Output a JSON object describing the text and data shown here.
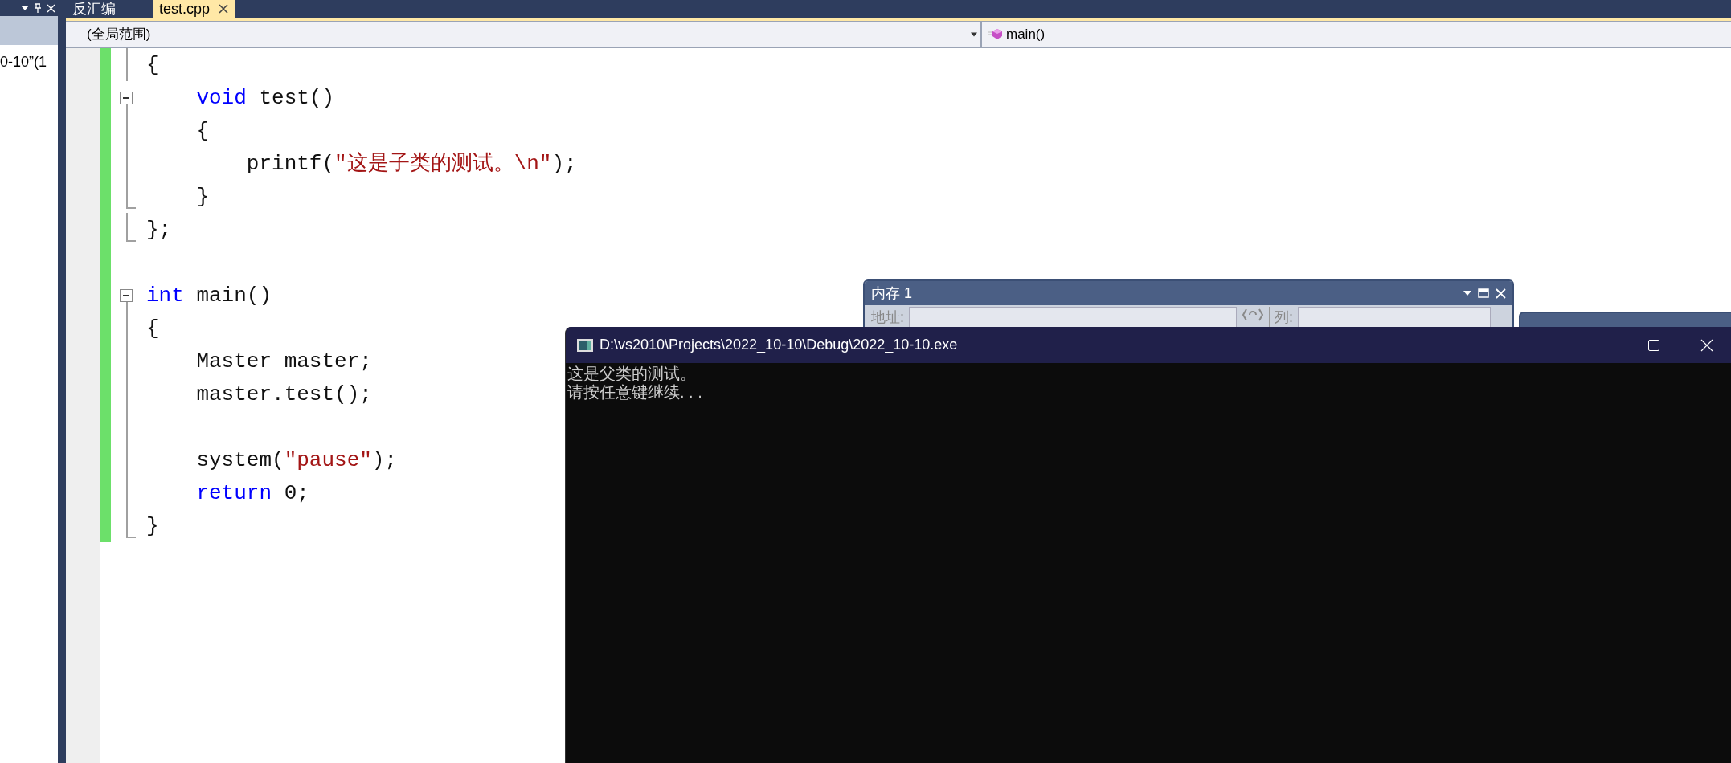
{
  "side_panel": {
    "text": "0-10”(1"
  },
  "tabs": [
    {
      "label": "反汇编",
      "selected": false,
      "closable": false
    },
    {
      "label": "test.cpp",
      "selected": true,
      "closable": true
    }
  ],
  "nav": {
    "scope": "(全局范围)",
    "member": "main()"
  },
  "code": [
    {
      "tokens": [
        {
          "text": "{",
          "kind": "plain"
        }
      ],
      "kind": "body",
      "changed": true
    },
    {
      "tokens": [
        {
          "text": "    void",
          "kind": "keyword"
        },
        {
          "text": " test()",
          "kind": "plain"
        }
      ],
      "kind": "start",
      "changed": true
    },
    {
      "tokens": [
        {
          "text": "    {",
          "kind": "plain"
        }
      ],
      "kind": "body",
      "changed": true
    },
    {
      "tokens": [
        {
          "text": "        printf(",
          "kind": "plain"
        },
        {
          "text": "\"这是子类的测试。\\n\"",
          "kind": "string"
        },
        {
          "text": ");",
          "kind": "plain"
        }
      ],
      "kind": "body",
      "changed": true
    },
    {
      "tokens": [
        {
          "text": "    }",
          "kind": "plain"
        }
      ],
      "kind": "end",
      "changed": true
    },
    {
      "tokens": [
        {
          "text": "};",
          "kind": "plain"
        }
      ],
      "kind": "end",
      "changed": true
    },
    {
      "kind": "blank",
      "changed": true
    },
    {
      "tokens": [
        {
          "text": "int",
          "kind": "keyword"
        },
        {
          "text": " main()",
          "kind": "plain"
        }
      ],
      "kind": "start",
      "changed": true
    },
    {
      "tokens": [
        {
          "text": "{",
          "kind": "plain"
        }
      ],
      "kind": "body",
      "changed": true
    },
    {
      "tokens": [
        {
          "text": "    Master master;",
          "kind": "plain"
        }
      ],
      "kind": "body",
      "changed": true
    },
    {
      "tokens": [
        {
          "text": "    master.test();",
          "kind": "plain"
        }
      ],
      "kind": "body",
      "changed": true
    },
    {
      "kind": "body",
      "changed": true
    },
    {
      "tokens": [
        {
          "text": "    system(",
          "kind": "plain"
        },
        {
          "text": "\"pause\"",
          "kind": "string"
        },
        {
          "text": ");",
          "kind": "plain"
        }
      ],
      "kind": "body",
      "changed": true
    },
    {
      "tokens": [
        {
          "text": "    return",
          "kind": "keyword"
        },
        {
          "text": " 0;",
          "kind": "plain"
        }
      ],
      "kind": "body",
      "changed": true
    },
    {
      "tokens": [
        {
          "text": "}",
          "kind": "plain"
        }
      ],
      "kind": "end",
      "changed": true
    }
  ],
  "memory_window": {
    "title": "内存 1",
    "address_label": "地址:",
    "column_label": "列:"
  },
  "console": {
    "title": "D:\\vs2010\\Projects\\2022_10-10\\Debug\\2022_10-10.exe",
    "lines": [
      "这是父类的测试。",
      "请按任意键继续. . ."
    ]
  }
}
